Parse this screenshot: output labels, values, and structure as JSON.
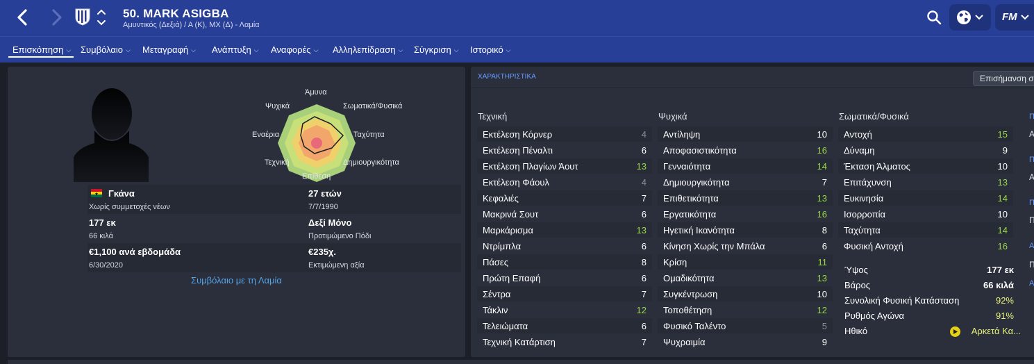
{
  "header": {
    "player_name": "50. MARK ASIGBA",
    "player_subtitle": "Αμυντικός (Δεξιά) / Α (Κ), ΜΧ (Δ) - Λαμία",
    "logo_text": "FM"
  },
  "tabs": [
    {
      "label": "Επισκόπηση"
    },
    {
      "label": "Συμβόλαιο"
    },
    {
      "label": "Μεταγραφή"
    },
    {
      "label": "Ανάπτυξη"
    },
    {
      "label": "Αναφορές"
    },
    {
      "label": "Αλληλεπίδραση"
    },
    {
      "label": "Σύγκριση"
    },
    {
      "label": "Ιστορικό"
    }
  ],
  "profile": {
    "nationality": "Γκάνα",
    "youth_caps": "Χωρίς συμμετοχές νέων",
    "height": "177 εκ",
    "weight": "66 κιλά",
    "wage": "€1,100 ανά εβδομάδα",
    "contract_end": "6/30/2020",
    "age": "27 ετών",
    "dob": "7/7/1990",
    "foot": "Δεξί Μόνο",
    "foot_label": "Προτιμώμενο Πόδι",
    "value": "€235χ.",
    "value_label": "Εκτιμώμενη αξία",
    "contract_link": "Συμβόλαιο με τη Λαμία"
  },
  "radar": {
    "labels": {
      "defending": "Άμυνα",
      "physical": "Σωματικά/Φυσικά",
      "speed": "Ταχύτητα",
      "creativity": "Δημιουργικότητα",
      "attacking": "Επίθεση",
      "technique": "Τεχνική",
      "aerial": "Εναέρια",
      "mental": "Ψυχικά"
    }
  },
  "attributes": {
    "title": "ΧΑΡΑΚΤΗΡΙΣΤΙΚΑ",
    "emphasis_button": "Επισήμανση σ",
    "technical_header": "Τεχνική",
    "mental_header": "Ψυχικά",
    "physical_header": "Σωματικά/Φυσικά",
    "technical": [
      {
        "name": "Εκτέλεση Κόρνερ",
        "value": "4"
      },
      {
        "name": "Εκτέλεση Πέναλτι",
        "value": "6"
      },
      {
        "name": "Εκτέλεση Πλαγίων Άουτ",
        "value": "13"
      },
      {
        "name": "Εκτέλεση Φάουλ",
        "value": "4"
      },
      {
        "name": "Κεφαλιές",
        "value": "7"
      },
      {
        "name": "Μακρινά Σουτ",
        "value": "6"
      },
      {
        "name": "Μαρκάρισμα",
        "value": "13"
      },
      {
        "name": "Ντρίμπλα",
        "value": "6"
      },
      {
        "name": "Πάσες",
        "value": "8"
      },
      {
        "name": "Πρώτη Επαφή",
        "value": "6"
      },
      {
        "name": "Σέντρα",
        "value": "7"
      },
      {
        "name": "Τάκλιν",
        "value": "12"
      },
      {
        "name": "Τελειώματα",
        "value": "6"
      },
      {
        "name": "Τεχνική Κατάρτιση",
        "value": "7"
      }
    ],
    "mental": [
      {
        "name": "Αντίληψη",
        "value": "10"
      },
      {
        "name": "Αποφασιστικότητα",
        "value": "16"
      },
      {
        "name": "Γενναιότητα",
        "value": "14"
      },
      {
        "name": "Δημιουργικότητα",
        "value": "7"
      },
      {
        "name": "Επιθετικότητα",
        "value": "13"
      },
      {
        "name": "Εργατικότητα",
        "value": "16"
      },
      {
        "name": "Ηγετική Ικανότητα",
        "value": "8"
      },
      {
        "name": "Κίνηση Χωρίς την Μπάλα",
        "value": "6"
      },
      {
        "name": "Κρίση",
        "value": "11"
      },
      {
        "name": "Ομαδικότητα",
        "value": "13"
      },
      {
        "name": "Συγκέντρωση",
        "value": "10"
      },
      {
        "name": "Τοποθέτηση",
        "value": "12"
      },
      {
        "name": "Φυσικό Ταλέντο",
        "value": "5"
      },
      {
        "name": "Ψυχραιμία",
        "value": "9"
      }
    ],
    "physical": [
      {
        "name": "Αντοχή",
        "value": "15"
      },
      {
        "name": "Δύναμη",
        "value": "9"
      },
      {
        "name": "Έκταση Άλματος",
        "value": "10"
      },
      {
        "name": "Επιτάχυνση",
        "value": "13"
      },
      {
        "name": "Ευκινησία",
        "value": "14"
      },
      {
        "name": "Ισορροπία",
        "value": "10"
      },
      {
        "name": "Ταχύτητα",
        "value": "14"
      },
      {
        "name": "Φυσική Αντοχή",
        "value": "16"
      }
    ],
    "extras": [
      {
        "name": "Ύψος",
        "value": "177 εκ"
      },
      {
        "name": "Βάρος",
        "value": "66 κιλά"
      },
      {
        "name": "Συνολική Φυσική Κατάσταση",
        "value": "92%"
      },
      {
        "name": "Ρυθμός Αγώνα",
        "value": "91%"
      },
      {
        "name": "Ηθικό",
        "value": "Αρκετά Κα..."
      }
    ],
    "side_letters": [
      "Π",
      "Α",
      "Π",
      "Α",
      "Π",
      "Π",
      "Α",
      "Π",
      "Α"
    ]
  },
  "colors": {
    "header_blue": "#283f97",
    "panel": "#2a2f3b",
    "good_value": "#9ad64a",
    "link": "#56a3e6",
    "morale": "#e6d213"
  }
}
